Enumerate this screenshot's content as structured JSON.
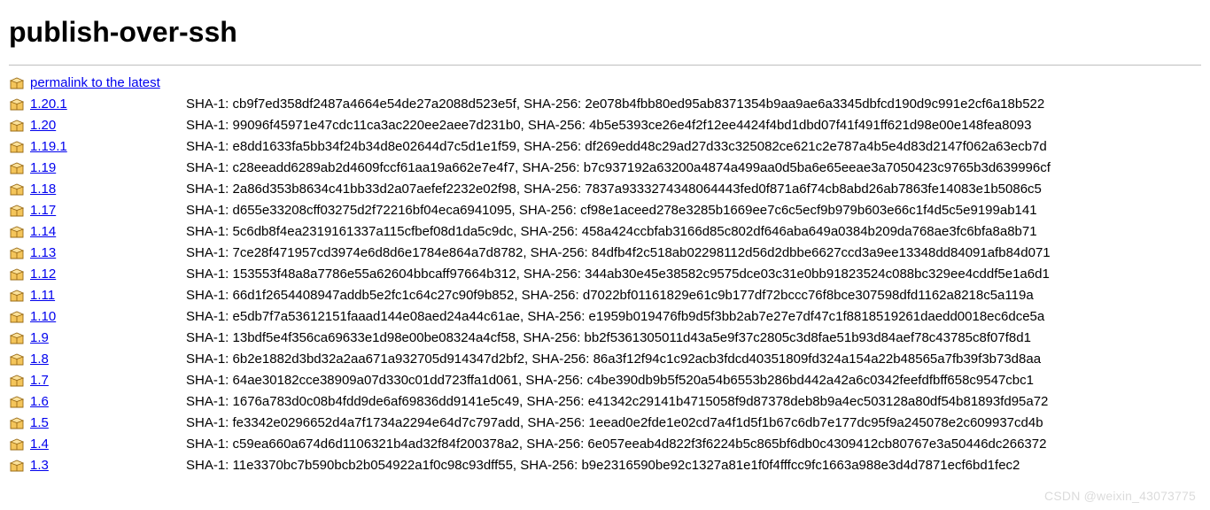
{
  "title": "publish-over-ssh",
  "permalink": {
    "label": "permalink to the latest"
  },
  "releases": [
    {
      "version": "1.20.1",
      "sha1": "cb9f7ed358df2487a4664e54de27a2088d523e5f",
      "sha256": "2e078b4fbb80ed95ab8371354b9aa9ae6a3345dbfcd190d9c991e2cf6a18b522"
    },
    {
      "version": "1.20",
      "sha1": "99096f45971e47cdc11ca3ac220ee2aee7d231b0",
      "sha256": "4b5e5393ce26e4f2f12ee4424f4bd1dbd07f41f491ff621d98e00e148fea8093"
    },
    {
      "version": "1.19.1",
      "sha1": "e8dd1633fa5bb34f24b34d8e02644d7c5d1e1f59",
      "sha256": "df269edd48c29ad27d33c325082ce621c2e787a4b5e4d83d2147f062a63ecb7d"
    },
    {
      "version": "1.19",
      "sha1": "c28eeadd6289ab2d4609fccf61aa19a662e7e4f7",
      "sha256": "b7c937192a63200a4874a499aa0d5ba6e65eeae3a7050423c9765b3d639996cf"
    },
    {
      "version": "1.18",
      "sha1": "2a86d353b8634c41bb33d2a07aefef2232e02f98",
      "sha256": "7837a9333274348064443fed0f871a6f74cb8abd26ab7863fe14083e1b5086c5"
    },
    {
      "version": "1.17",
      "sha1": "d655e33208cff03275d2f72216bf04eca6941095",
      "sha256": "cf98e1aceed278e3285b1669ee7c6c5ecf9b979b603e66c1f4d5c5e9199ab141"
    },
    {
      "version": "1.14",
      "sha1": "5c6db8f4ea2319161337a115cfbef08d1da5c9dc",
      "sha256": "458a424ccbfab3166d85c802df646aba649a0384b209da768ae3fc6bfa8a8b71"
    },
    {
      "version": "1.13",
      "sha1": "7ce28f471957cd3974e6d8d6e1784e864a7d8782",
      "sha256": "84dfb4f2c518ab02298112d56d2dbbe6627ccd3a9ee13348dd84091afb84d071"
    },
    {
      "version": "1.12",
      "sha1": "153553f48a8a7786e55a62604bbcaff97664b312",
      "sha256": "344ab30e45e38582c9575dce03c31e0bb91823524c088bc329ee4cddf5e1a6d1"
    },
    {
      "version": "1.11",
      "sha1": "66d1f2654408947addb5e2fc1c64c27c90f9b852",
      "sha256": "d7022bf01161829e61c9b177df72bccc76f8bce307598dfd1162a8218c5a119a"
    },
    {
      "version": "1.10",
      "sha1": "e5db7f7a53612151faaad144e08aed24a44c61ae",
      "sha256": "e1959b019476fb9d5f3bb2ab7e27e7df47c1f8818519261daedd0018ec6dce5a"
    },
    {
      "version": "1.9",
      "sha1": "13bdf5e4f356ca69633e1d98e00be08324a4cf58",
      "sha256": "bb2f5361305011d43a5e9f37c2805c3d8fae51b93d84aef78c43785c8f07f8d1"
    },
    {
      "version": "1.8",
      "sha1": "6b2e1882d3bd32a2aa671a932705d914347d2bf2",
      "sha256": "86a3f12f94c1c92acb3fdcd40351809fd324a154a22b48565a7fb39f3b73d8aa"
    },
    {
      "version": "1.7",
      "sha1": "64ae30182cce38909a07d330c01dd723ffa1d061",
      "sha256": "c4be390db9b5f520a54b6553b286bd442a42a6c0342feefdfbff658c9547cbc1"
    },
    {
      "version": "1.6",
      "sha1": "1676a783d0c08b4fdd9de6af69836dd9141e5c49",
      "sha256": "e41342c29141b4715058f9d87378deb8b9a4ec503128a80df54b81893fd95a72"
    },
    {
      "version": "1.5",
      "sha1": "fe3342e0296652d4a7f1734a2294e64d7c797add",
      "sha256": "1eead0e2fde1e02cd7a4f1d5f1b67c6db7e177dc95f9a245078e2c609937cd4b"
    },
    {
      "version": "1.4",
      "sha1": "c59ea660a674d6d1106321b4ad32f84f200378a2",
      "sha256": "6e057eeab4d822f3f6224b5c865bf6db0c4309412cb80767e3a50446dc266372"
    },
    {
      "version": "1.3",
      "sha1": "11e3370bc7b590bcb2b054922a1f0c98c93dff55",
      "sha256": "b9e2316590be92c1327a81e1f0f4fffcc9fc1663a988e3d4d7871ecf6bd1fec2"
    }
  ],
  "labels": {
    "sha1_prefix": "SHA-1: ",
    "sha256_prefix": ", SHA-256: "
  },
  "watermark": "CSDN @weixin_43073775"
}
